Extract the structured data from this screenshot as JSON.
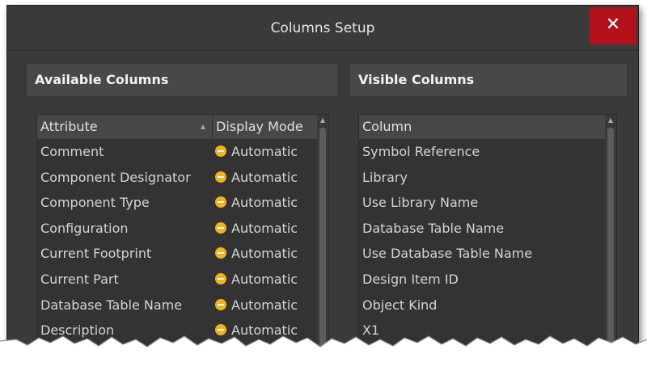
{
  "dialog": {
    "title": "Columns Setup",
    "close_label": "✕"
  },
  "available": {
    "header": "Available Columns",
    "col_attribute": "Attribute",
    "col_display_mode": "Display Mode",
    "rows": [
      {
        "attribute": "Comment",
        "mode": "Automatic"
      },
      {
        "attribute": "Component Designator",
        "mode": "Automatic"
      },
      {
        "attribute": "Component Type",
        "mode": "Automatic"
      },
      {
        "attribute": "Configuration",
        "mode": "Automatic"
      },
      {
        "attribute": "Current Footprint",
        "mode": "Automatic"
      },
      {
        "attribute": "Current Part",
        "mode": "Automatic"
      },
      {
        "attribute": "Database Table Name",
        "mode": "Automatic"
      },
      {
        "attribute": "Description",
        "mode": "Automatic"
      }
    ]
  },
  "visible": {
    "header": "Visible Columns",
    "col_column": "Column",
    "rows": [
      "Symbol Reference",
      "Library",
      "Use Library Name",
      "Database Table Name",
      "Use Database Table Name",
      "Design Item ID",
      "Object Kind",
      "X1"
    ]
  },
  "icons": {
    "mode": "automatic-mode-icon",
    "sort": "sort-ascending-icon",
    "scroll_up": "scroll-up-arrow-icon"
  },
  "colors": {
    "close": "#b3121a",
    "mode_dot": "#f2b21c",
    "dialog_bg": "#3a3a3a"
  }
}
